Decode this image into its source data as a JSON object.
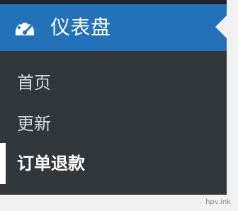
{
  "sidebar": {
    "header": {
      "icon": "dashboard-icon",
      "title": "仪表盘"
    },
    "submenu": [
      {
        "label": "首页",
        "active": false
      },
      {
        "label": "更新",
        "active": false
      },
      {
        "label": "订单退款",
        "active": true
      }
    ]
  },
  "watermark": "hpv.ink",
  "colors": {
    "header_blue": "#2372b9",
    "sidebar_dark": "#23282d",
    "submenu_dark": "#32373c",
    "text_light": "#d7d9db",
    "active_text": "#ffffff",
    "page_bg": "#f1f1f1"
  }
}
